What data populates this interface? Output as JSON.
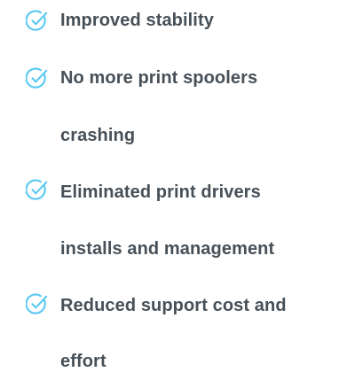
{
  "benefits": {
    "items": [
      {
        "lines": [
          "Improved stability"
        ],
        "icon": "check-circle-icon"
      },
      {
        "lines": [
          "No more print spoolers",
          "crashing"
        ],
        "icon": "check-circle-icon"
      },
      {
        "lines": [
          "Eliminated print drivers",
          "installs and management"
        ],
        "icon": "check-circle-icon"
      },
      {
        "lines": [
          "Reduced support cost and",
          "effort"
        ],
        "icon": "check-circle-icon"
      }
    ],
    "icon_color": "#58c8f2",
    "text_color": "#475058"
  }
}
